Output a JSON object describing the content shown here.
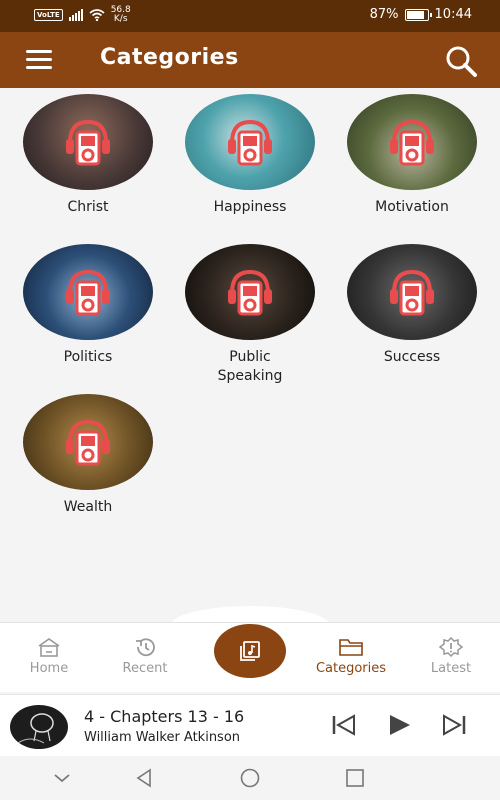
{
  "status_bar": {
    "volte": "VoLTE",
    "speed_value": "56.8",
    "speed_unit": "K/s",
    "battery": "87%",
    "time": "10:44"
  },
  "app_bar": {
    "title": "Categories"
  },
  "categories": [
    {
      "label": "Christ"
    },
    {
      "label": "Happiness"
    },
    {
      "label": "Motivation"
    },
    {
      "label": "Politics"
    },
    {
      "label": "Public\nSpeaking"
    },
    {
      "label": "Success"
    },
    {
      "label": "Wealth"
    }
  ],
  "bottom_nav": {
    "home": "Home",
    "recent": "Recent",
    "categories": "Categories",
    "latest": "Latest"
  },
  "player": {
    "title": "4 - Chapters 13 - 16",
    "author": "William Walker Atkinson"
  },
  "colors": {
    "primary": "#8a4512",
    "status_bar": "#5c2e08",
    "icon_red": "#e84c4c"
  }
}
